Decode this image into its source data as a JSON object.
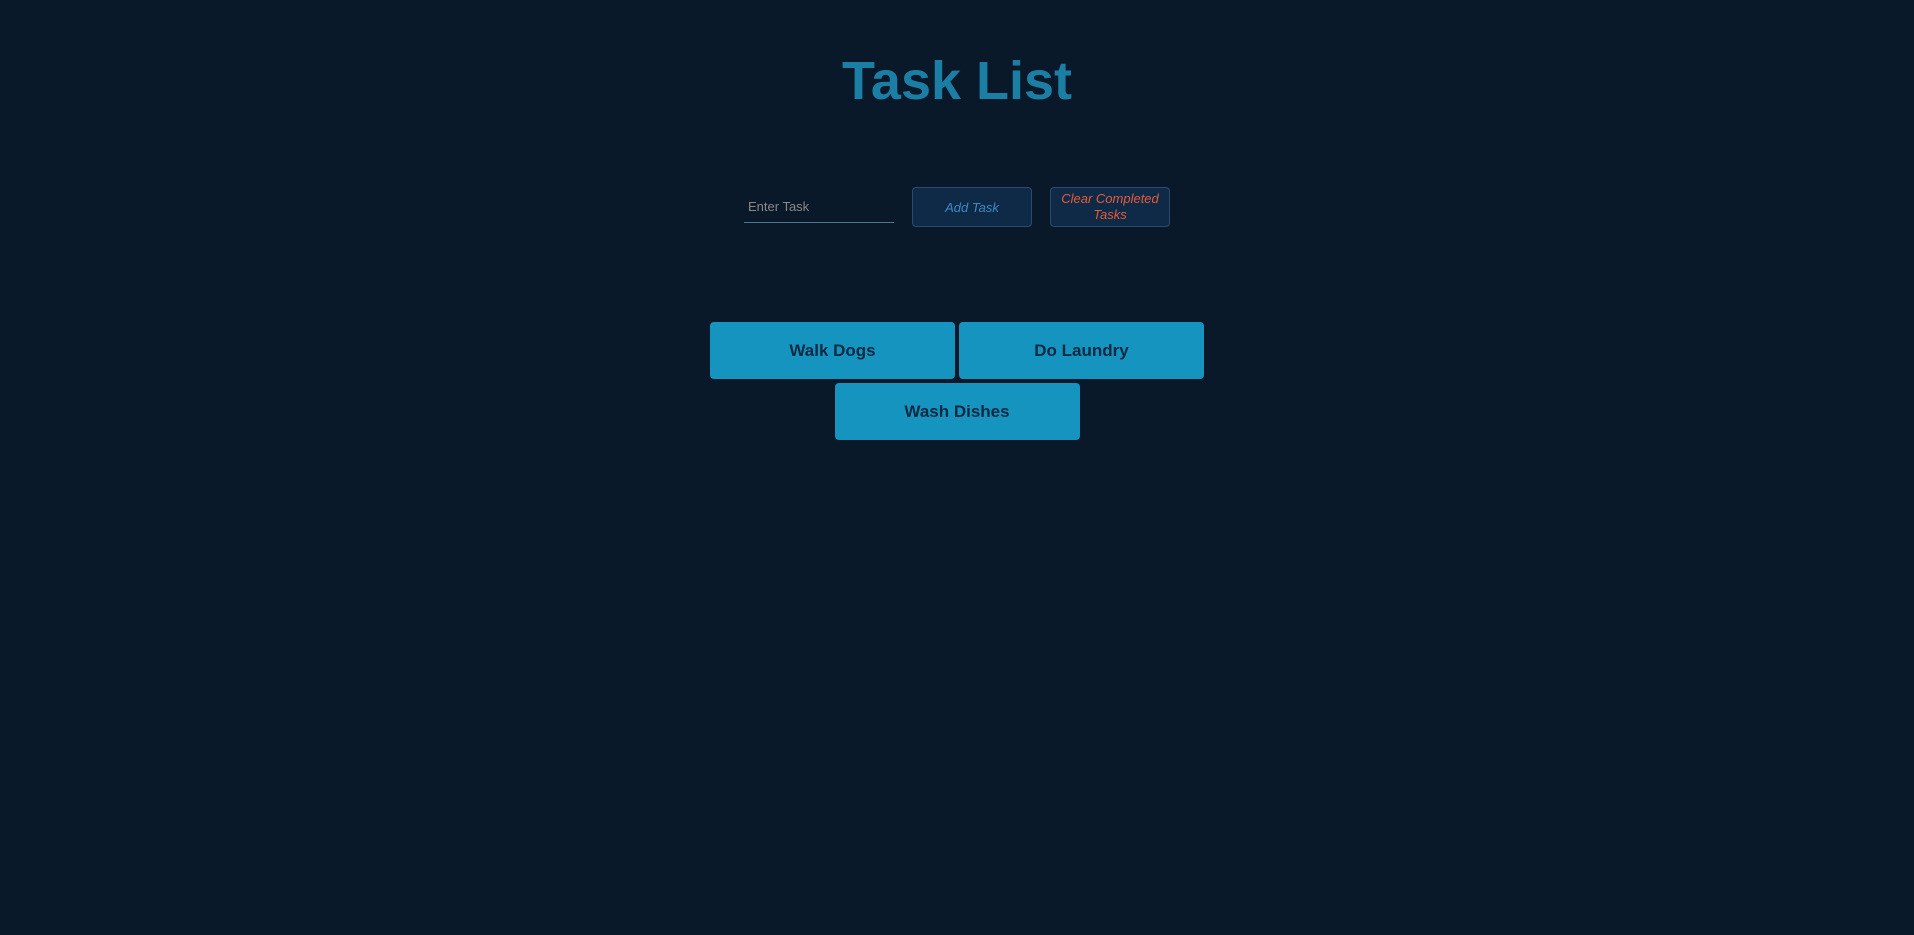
{
  "header": {
    "title": "Task List"
  },
  "controls": {
    "input_placeholder": "Enter Task",
    "add_button_label": "Add Task",
    "clear_button_label": "Clear Completed Tasks"
  },
  "tasks": [
    {
      "label": "Walk Dogs"
    },
    {
      "label": "Do Laundry"
    },
    {
      "label": "Wash Dishes"
    }
  ]
}
